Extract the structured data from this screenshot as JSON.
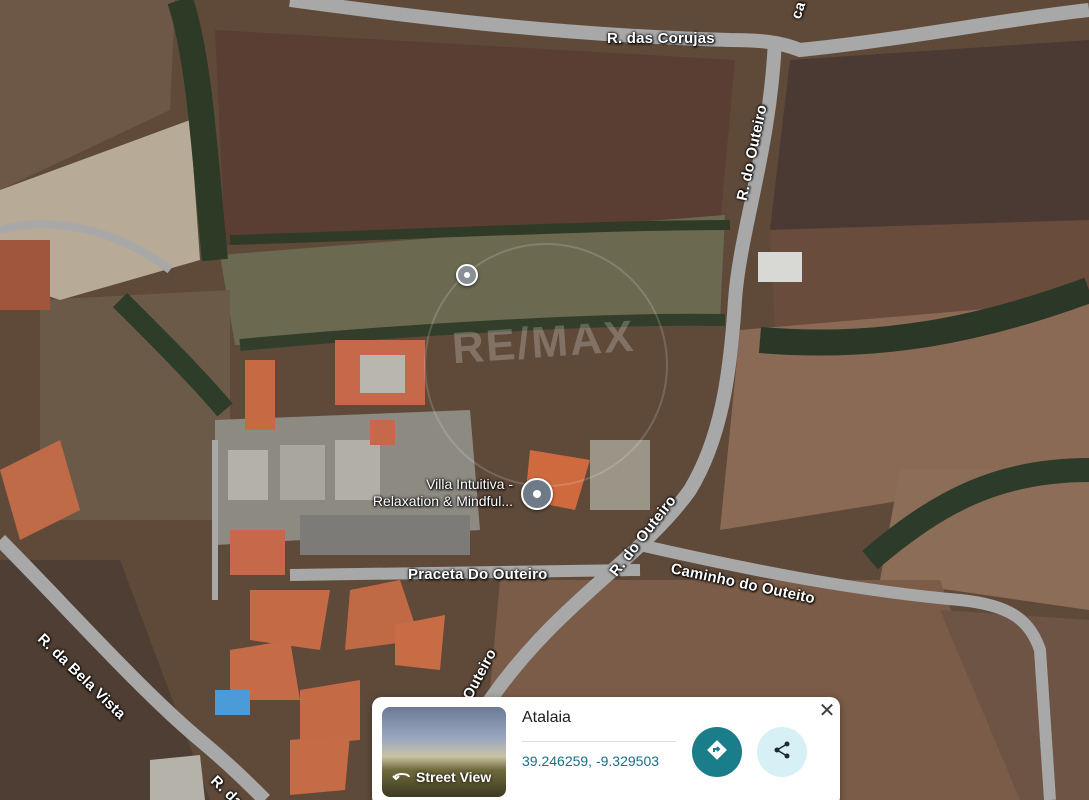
{
  "map": {
    "road_labels": {
      "das_corujas": "R. das Corujas",
      "do_outeiro_north": "R. do Outeiro",
      "do_outeiro_east_top": "ca",
      "do_outeiro_mid": "R. do Outeiro",
      "outeiro_south": "Outeiro",
      "caminho_do_outeiro": "Caminho do Outeito",
      "praceta_do_outeiro": "Praceta Do Outeiro",
      "bela_vista": "R. da Bela Vista",
      "r_da_bottom": "R. da"
    },
    "place": {
      "line1": "Villa Intuitiva -",
      "line2": "Relaxation & Mindful..."
    },
    "watermark": "RE/MAX",
    "colors": {
      "road": "#a8a8a8",
      "pin_place": "#6e7a86",
      "pin_plain": "#8a8f95"
    }
  },
  "card": {
    "title": "Atalaia",
    "coordinates": "39.246259, -9.329503",
    "street_view_label": "Street View",
    "directions_icon": "directions-icon",
    "share_icon": "share-icon",
    "close_icon": "close-icon",
    "accent_color": "#197d8a"
  }
}
